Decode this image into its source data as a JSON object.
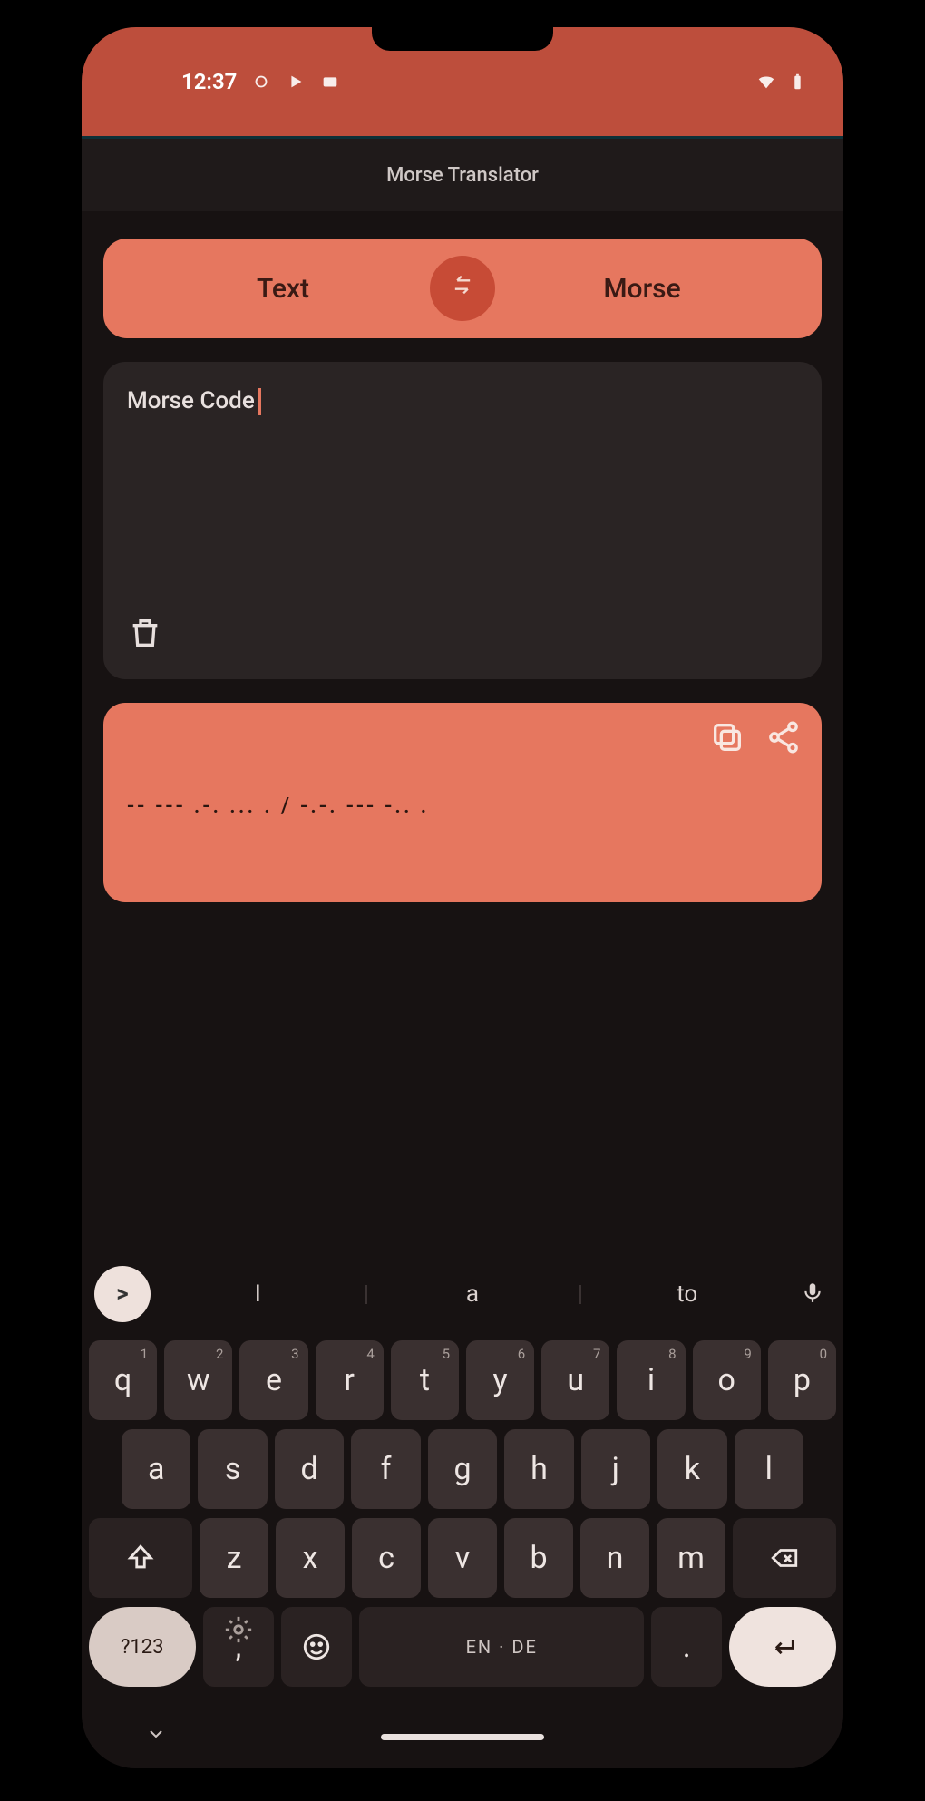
{
  "status": {
    "time": "12:37"
  },
  "appbar": {
    "title": "Morse Translator"
  },
  "toggle": {
    "left": "Text",
    "right": "Morse"
  },
  "input": {
    "text": "Morse Code"
  },
  "output": {
    "morse": "-- --- .-. ... . / -.-. --- -.. ."
  },
  "suggest": {
    "chip": ">",
    "s1": "I",
    "s2": "a",
    "s3": "to"
  },
  "kb": {
    "row1": [
      {
        "k": "q",
        "n": "1"
      },
      {
        "k": "w",
        "n": "2"
      },
      {
        "k": "e",
        "n": "3"
      },
      {
        "k": "r",
        "n": "4"
      },
      {
        "k": "t",
        "n": "5"
      },
      {
        "k": "y",
        "n": "6"
      },
      {
        "k": "u",
        "n": "7"
      },
      {
        "k": "i",
        "n": "8"
      },
      {
        "k": "o",
        "n": "9"
      },
      {
        "k": "p",
        "n": "0"
      }
    ],
    "row2": [
      "a",
      "s",
      "d",
      "f",
      "g",
      "h",
      "j",
      "k",
      "l"
    ],
    "row3": [
      "z",
      "x",
      "c",
      "v",
      "b",
      "n",
      "m"
    ],
    "symnum": "?123",
    "comma": ",",
    "spacelabel": "EN · DE",
    "period": "."
  }
}
